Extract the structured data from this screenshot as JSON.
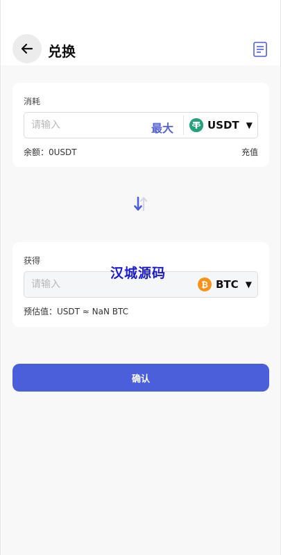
{
  "header": {
    "title": "兑换",
    "back_icon": "arrow-left-icon",
    "records_icon": "document-list-icon"
  },
  "consume": {
    "label": "消耗",
    "placeholder": "请输入",
    "max_label": "最大",
    "coin": "USDT",
    "coin_icon": "tether-icon",
    "balance_label": "余额：",
    "balance_value": "0USDT",
    "recharge_label": "充值"
  },
  "swap": {
    "icon": "swap-arrows-icon"
  },
  "receive": {
    "label": "获得",
    "placeholder": "请输入",
    "coin": "BTC",
    "coin_icon": "bitcoin-icon",
    "estimate_label": "预估值：",
    "estimate_value": "USDT ≈ NaN BTC"
  },
  "confirm_label": "确认",
  "watermark": "汉城源码",
  "colors": {
    "accent": "#4c5fdb",
    "max": "#5563d9",
    "tether": "#26a17b",
    "bitcoin": "#f7931a"
  }
}
